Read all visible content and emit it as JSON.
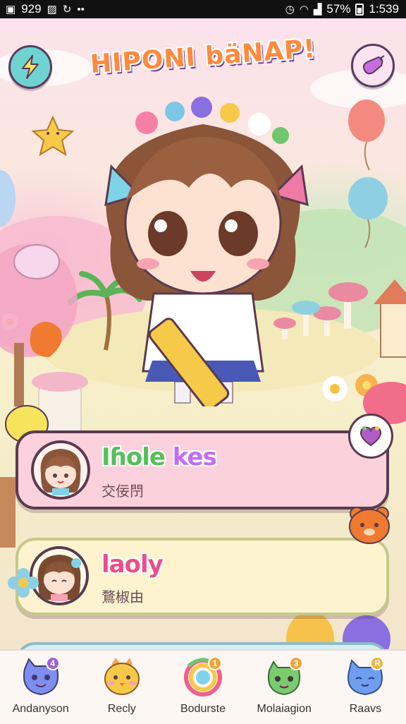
{
  "status_bar": {
    "time_left": "929",
    "battery": "57%",
    "clock": "1:539"
  },
  "header": {
    "title": "HIPONI bäNAP!",
    "left_button_icon": "lightning-bolt-icon",
    "right_button_icon": "candy-icon"
  },
  "chats": [
    {
      "name_a": "Iɦole ",
      "name_b": "kes",
      "subtitle": "交佞閅"
    },
    {
      "name": "laoly",
      "subtitle": "鶩椒由"
    }
  ],
  "bottom_nav": {
    "items": [
      {
        "label": "Andanyson",
        "icon": "blue-monster-icon",
        "badge": "4"
      },
      {
        "label": "Recly",
        "icon": "yellow-bird-icon",
        "badge": ""
      },
      {
        "label": "Bodurste",
        "icon": "rainbow-ring-icon",
        "badge": "1"
      },
      {
        "label": "Molaiagion",
        "icon": "green-dino-icon",
        "badge": "3"
      },
      {
        "label": "Raavs",
        "icon": "blue-cat-icon",
        "badge": "R"
      }
    ]
  },
  "colors": {
    "accent": "#ff8a3d",
    "card1_bg": "#fbd1dd",
    "card2_bg": "#fdf4cf",
    "nav_bg": "#fdf7f4"
  }
}
